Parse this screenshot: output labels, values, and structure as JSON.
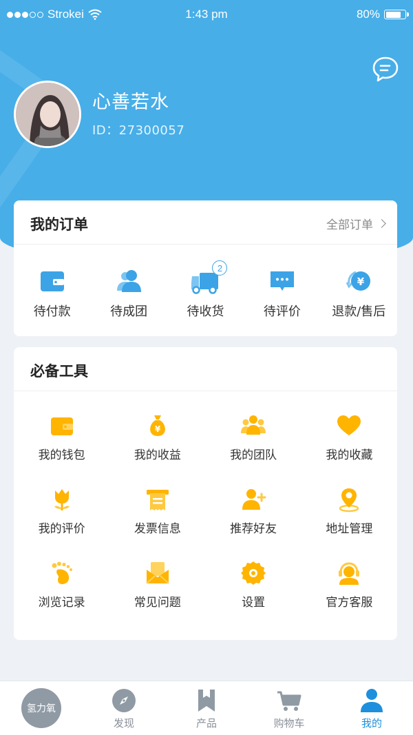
{
  "status_bar": {
    "carrier": "Strokei",
    "time": "1:43 pm",
    "battery": "80%",
    "battery_level": 0.8
  },
  "profile": {
    "name": "心善若水",
    "id_text": "ID：27300057"
  },
  "orders": {
    "title": "我的订单",
    "all_link": "全部订单",
    "items": [
      {
        "label": "待付款",
        "icon": "wallet-icon"
      },
      {
        "label": "待成团",
        "icon": "group-icon"
      },
      {
        "label": "待收货",
        "icon": "truck-icon",
        "badge": "2"
      },
      {
        "label": "待评价",
        "icon": "comment-icon"
      },
      {
        "label": "退款/售后",
        "icon": "refund-icon"
      }
    ]
  },
  "tools": {
    "title": "必备工具",
    "items": [
      {
        "label": "我的钱包",
        "icon": "wallet-icon"
      },
      {
        "label": "我的收益",
        "icon": "money-bag-icon"
      },
      {
        "label": "我的团队",
        "icon": "team-icon"
      },
      {
        "label": "我的收藏",
        "icon": "heart-icon"
      },
      {
        "label": "我的评价",
        "icon": "flower-icon"
      },
      {
        "label": "发票信息",
        "icon": "invoice-icon"
      },
      {
        "label": "推荐好友",
        "icon": "add-friend-icon"
      },
      {
        "label": "地址管理",
        "icon": "location-icon"
      },
      {
        "label": "浏览记录",
        "icon": "footprint-icon"
      },
      {
        "label": "常见问题",
        "icon": "envelope-icon"
      },
      {
        "label": "设置",
        "icon": "gear-icon"
      },
      {
        "label": "官方客服",
        "icon": "headset-icon"
      }
    ]
  },
  "tabbar": {
    "brand": "氢力氧",
    "items": [
      {
        "label": "发现",
        "icon": "compass-icon"
      },
      {
        "label": "产品",
        "icon": "bookmark-icon"
      },
      {
        "label": "购物车",
        "icon": "cart-icon"
      },
      {
        "label": "我的",
        "icon": "user-icon",
        "active": true
      }
    ]
  },
  "colors": {
    "primary": "#47aee8",
    "accent_blue": "#3ca3e6",
    "tool_yellow": "#ffb400",
    "tab_active": "#1e8fdc"
  }
}
